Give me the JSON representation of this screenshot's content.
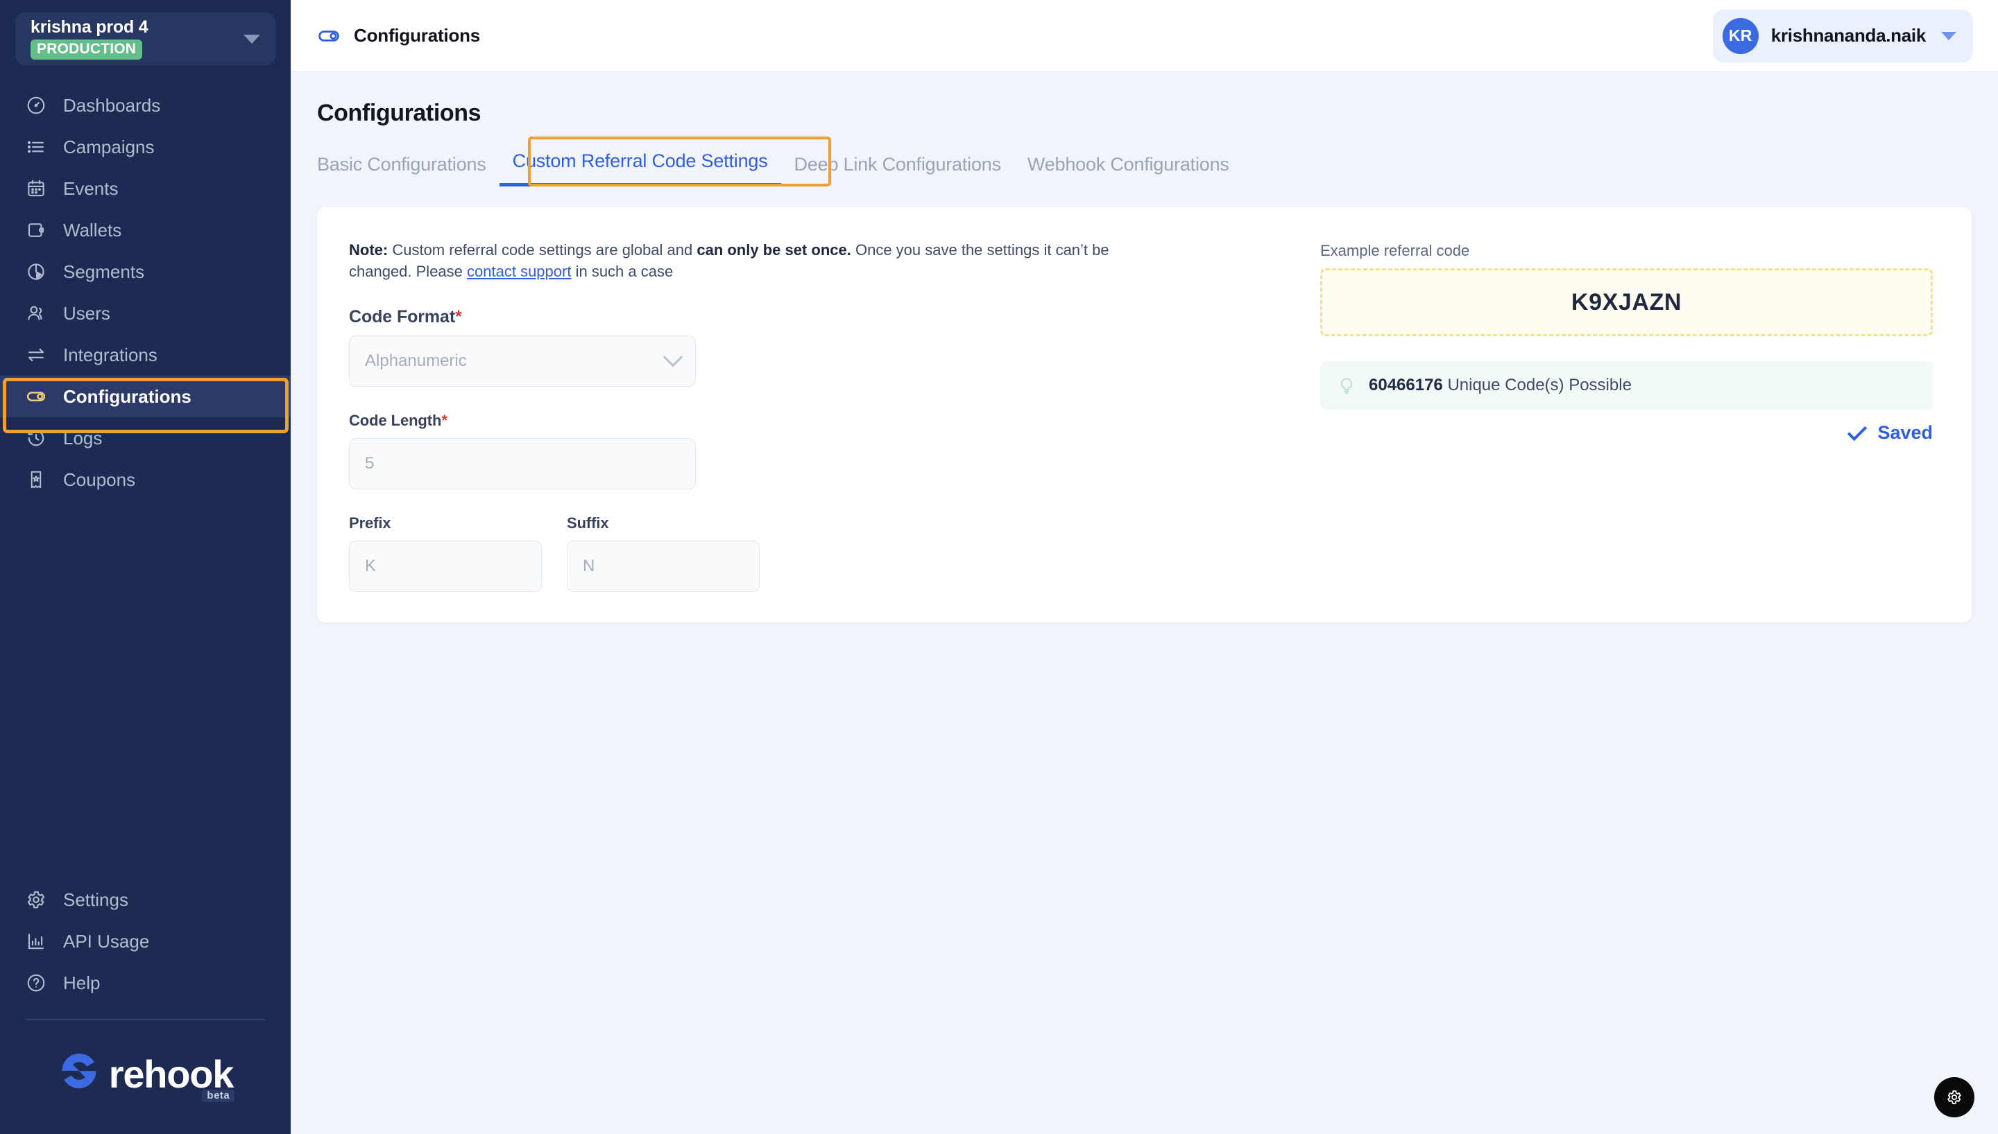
{
  "sidebar": {
    "project": {
      "name": "krishna prod 4",
      "env_badge": "PRODUCTION"
    },
    "items": [
      {
        "label": "Dashboards",
        "icon": "gauge-icon"
      },
      {
        "label": "Campaigns",
        "icon": "list-icon"
      },
      {
        "label": "Events",
        "icon": "calendar-icon"
      },
      {
        "label": "Wallets",
        "icon": "wallet-icon"
      },
      {
        "label": "Segments",
        "icon": "pie-chart-icon"
      },
      {
        "label": "Users",
        "icon": "users-icon"
      },
      {
        "label": "Integrations",
        "icon": "arrows-exchange-icon"
      },
      {
        "label": "Configurations",
        "icon": "toggle-icon"
      },
      {
        "label": "Logs",
        "icon": "history-clock-icon"
      },
      {
        "label": "Coupons",
        "icon": "ticket-star-icon"
      }
    ],
    "bottom_items": [
      {
        "label": "Settings",
        "icon": "gear-icon"
      },
      {
        "label": "API Usage",
        "icon": "bar-chart-icon"
      },
      {
        "label": "Help",
        "icon": "question-circle-icon"
      }
    ],
    "brand": {
      "name": "rehook",
      "tag": "beta"
    },
    "active_item": "Configurations",
    "active_icon_color": "#f3d47a",
    "annotation_color": "#f0a030"
  },
  "topbar": {
    "icon": "toggle-icon",
    "title": "Configurations",
    "user": {
      "initials": "KR",
      "name": "krishnananda.naik"
    }
  },
  "page": {
    "title": "Configurations",
    "tabs": [
      {
        "label": "Basic Configurations",
        "active": false
      },
      {
        "label": "Custom Referral Code Settings",
        "active": true
      },
      {
        "label": "Deep Link Configurations",
        "active": false
      },
      {
        "label": "Webhook Configurations",
        "active": false
      }
    ]
  },
  "form": {
    "note": {
      "prefix_bold": "Note:",
      "part1": " Custom referral code settings are global and ",
      "bold2": " can only be set once.",
      "part2": " Once you save the settings it can’t be changed. Please ",
      "link": "contact support",
      "part3": " in such a case"
    },
    "code_format": {
      "label": "Code Format",
      "required": "*",
      "value": "Alphanumeric"
    },
    "code_length": {
      "label": "Code Length",
      "required": "*",
      "value": "5"
    },
    "prefix": {
      "label": "Prefix",
      "value": "K"
    },
    "suffix": {
      "label": "Suffix",
      "value": "N"
    },
    "save_status": "Saved"
  },
  "preview": {
    "label": "Example referral code",
    "code": "K9XJAZN",
    "hint_count": "60466176",
    "hint_text": " Unique Code(s) Possible"
  },
  "fab": {
    "icon": "gear-icon"
  },
  "colors": {
    "sidebar_bg": "#1d2b53",
    "accent_blue": "#2f5fe0",
    "annotation_orange": "#f0a030",
    "badge_green": "#63be8b",
    "canvas": "#f1f4fb"
  }
}
